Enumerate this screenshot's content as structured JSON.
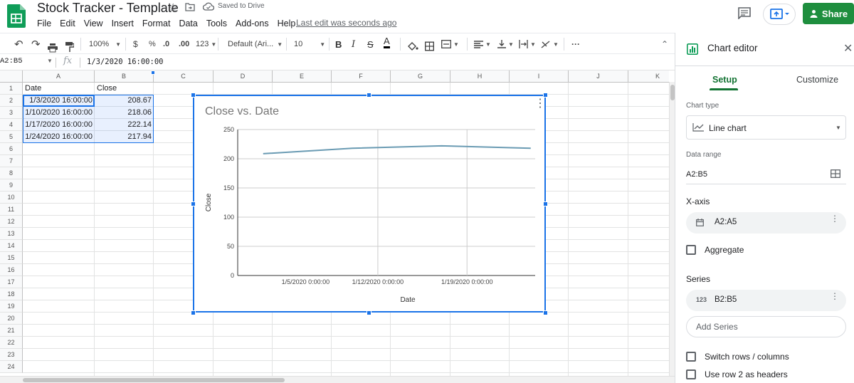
{
  "header": {
    "title": "Stock Tracker - Template",
    "saved_status": "Saved to Drive",
    "last_edit": "Last edit was seconds ago",
    "share_label": "Share",
    "menu": [
      "File",
      "Edit",
      "View",
      "Insert",
      "Format",
      "Data",
      "Tools",
      "Add-ons",
      "Help"
    ]
  },
  "toolbar": {
    "zoom": "100%",
    "currency": "$",
    "percent": "%",
    "decrease_decimals": ".0",
    "increase_decimals": ".00",
    "more_formats": "123",
    "font": "Default (Ari...",
    "font_size": "10",
    "more": "···"
  },
  "formula_bar": {
    "name_box": "A2:B5",
    "fx": "fx",
    "value": "1/3/2020 16:00:00"
  },
  "grid": {
    "columns": [
      "A",
      "B",
      "C",
      "D",
      "E",
      "F",
      "G",
      "H",
      "I",
      "J",
      "K"
    ],
    "rows": [
      "1",
      "2",
      "3",
      "4",
      "5",
      "6",
      "7",
      "8",
      "9",
      "10",
      "11",
      "12",
      "13",
      "14",
      "15",
      "16",
      "17",
      "18",
      "19",
      "20",
      "21",
      "22",
      "23",
      "24"
    ],
    "cells": {
      "A1": "Date",
      "B1": "Close",
      "A2": "1/3/2020 16:00:00",
      "B2": "208.67",
      "A3": "1/10/2020 16:00:00",
      "B3": "218.06",
      "A4": "1/17/2020 16:00:00",
      "B4": "222.14",
      "A5": "1/24/2020 16:00:00",
      "B5": "217.94"
    }
  },
  "chart_data": {
    "type": "line",
    "title": "Close vs. Date",
    "xlabel": "Date",
    "ylabel": "Close",
    "x": [
      "1/3/2020",
      "1/10/2020",
      "1/17/2020",
      "1/24/2020"
    ],
    "x_ticks": [
      "1/5/2020 0:00:00",
      "1/12/2020 0:00:00",
      "1/19/2020 0:00:00"
    ],
    "series": [
      {
        "values": [
          208.67,
          218.06,
          222.14,
          217.94
        ]
      }
    ],
    "ylim": [
      0,
      250
    ],
    "y_ticks": [
      "0",
      "50",
      "100",
      "150",
      "200",
      "250"
    ],
    "grid": true,
    "line_color": "#6a9bb3"
  },
  "editor": {
    "title": "Chart editor",
    "tabs": [
      "Setup",
      "Customize"
    ],
    "chart_type_label": "Chart type",
    "chart_type_value": "Line chart",
    "data_range_label": "Data range",
    "data_range_value": "A2:B5",
    "xaxis_label": "X-axis",
    "xaxis_value": "A2:A5",
    "aggregate_label": "Aggregate",
    "series_label": "Series",
    "series_value": "B2:B5",
    "series_icon": "123",
    "add_series_label": "Add Series",
    "switch_label": "Switch rows / columns",
    "headers_label": "Use row 2 as headers"
  },
  "colors": {
    "accent_green": "#1e8e3e",
    "selection_blue": "#1a73e8"
  }
}
